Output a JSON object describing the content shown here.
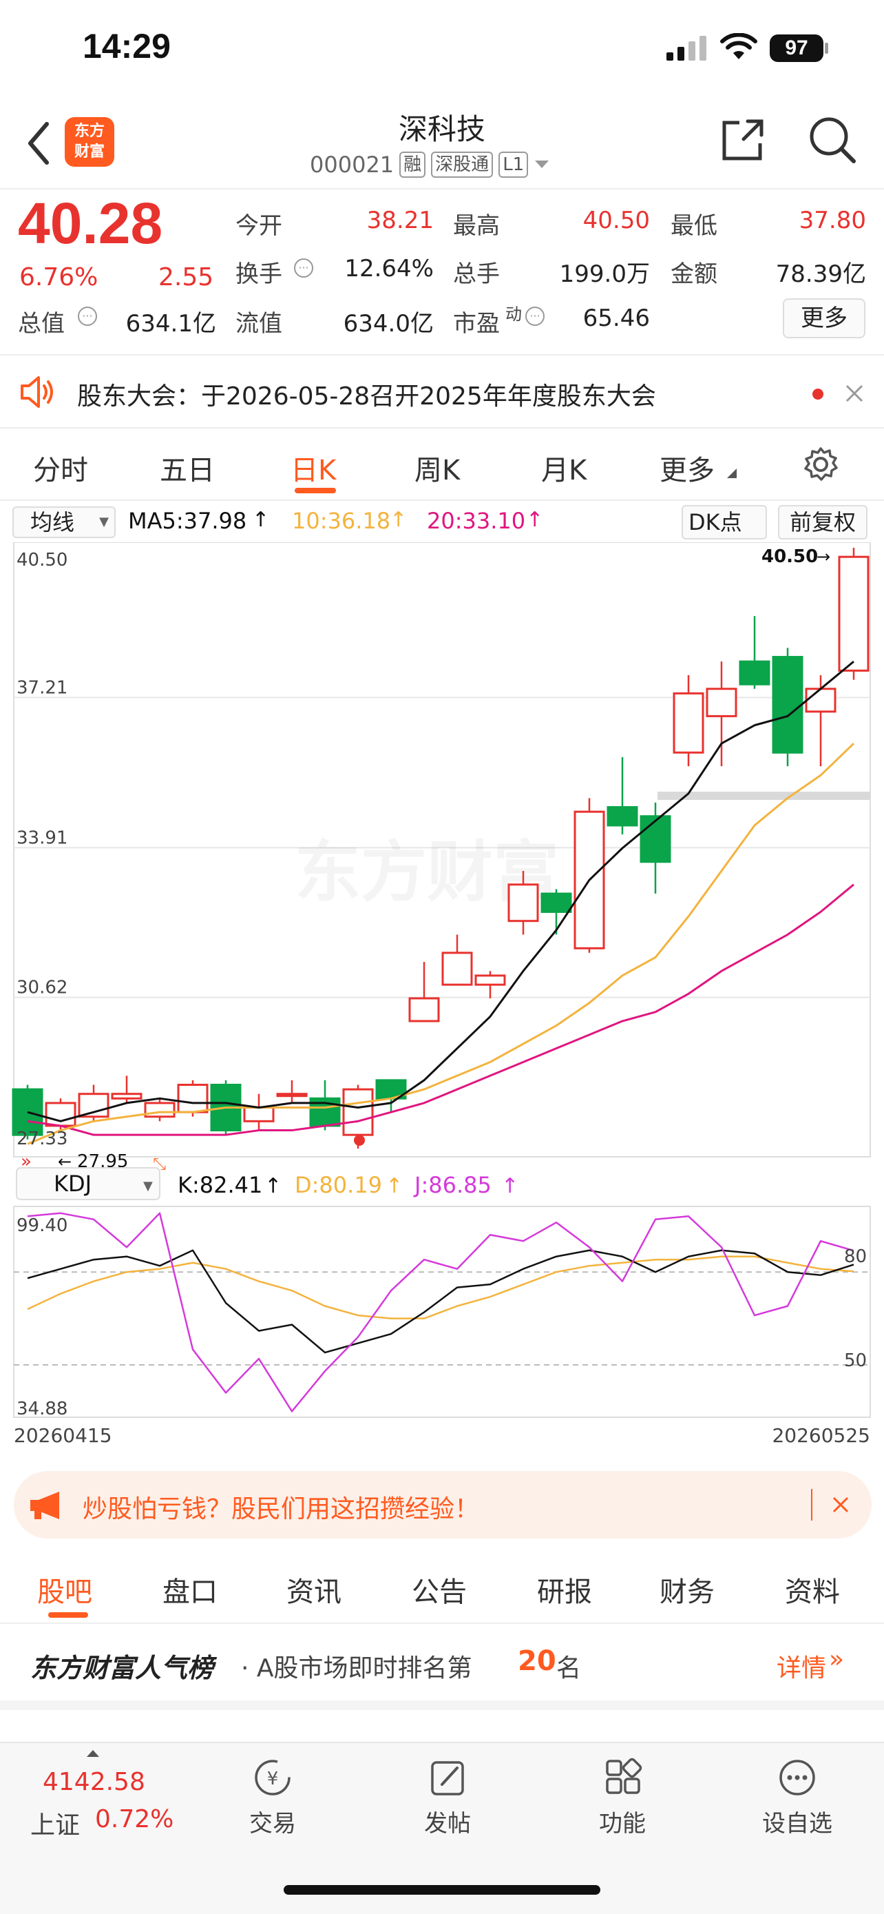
{
  "status_bar": {
    "time": "14:29",
    "battery": "97"
  },
  "header": {
    "back_label": "",
    "logo_line1": "东方",
    "logo_line2": "财富",
    "title": "深科技",
    "code": "000021",
    "tags": [
      "融",
      "深股通",
      "L1"
    ]
  },
  "quote": {
    "price": "40.28",
    "change_pct": "6.76%",
    "change": "2.55",
    "open_label": "今开",
    "open": "38.21",
    "high_label": "最高",
    "high": "40.50",
    "low_label": "最低",
    "low": "37.80",
    "turnover_label": "换手",
    "turnover": "12.64%",
    "volume_label": "总手",
    "volume": "199.0万",
    "amount_label": "金额",
    "amount": "78.39亿",
    "mktcap_label": "总值",
    "mktcap": "634.1亿",
    "float_label": "流值",
    "float_cap": "634.0亿",
    "pe_label": "市盈",
    "pe_sup": "动",
    "pe": "65.46",
    "more_button": "更多"
  },
  "notice": {
    "text": "股东大会：于2026-05-28召开2025年年度股东大会"
  },
  "chart_tabs": [
    "分时",
    "五日",
    "日K",
    "周K",
    "月K",
    "更多"
  ],
  "chart_tabs_active": 2,
  "ma_bar": {
    "selector": "均线",
    "ma5": "MA5:37.98",
    "ma10": "10:36.18",
    "ma20": "20:33.10",
    "dk_button": "DK点",
    "adjust_button": "前复权"
  },
  "colors": {
    "up": "#e8322e",
    "down": "#0aa44a",
    "ma5": "#111111",
    "ma10": "#f3b33d",
    "ma20": "#e0157f",
    "j_line": "#d43adb",
    "accent": "#ff5a1f"
  },
  "chart_data": {
    "type": "candlestick",
    "y_labels": [
      "40.50",
      "37.21",
      "33.91",
      "30.62",
      "27.33"
    ],
    "ylim": [
      27.33,
      40.5
    ],
    "high_marker": "40.50",
    "low_marker": "27.95",
    "x_start": "20260415",
    "x_end": "20260525",
    "watermark": "东方财富",
    "candles": [
      {
        "o": 28.6,
        "c": 27.6,
        "h": 28.7,
        "l": 27.5
      },
      {
        "o": 27.8,
        "c": 28.3,
        "h": 28.4,
        "l": 27.7
      },
      {
        "o": 28.0,
        "c": 28.5,
        "h": 28.7,
        "l": 27.9
      },
      {
        "o": 28.4,
        "c": 28.5,
        "h": 28.9,
        "l": 28.3
      },
      {
        "o": 28.0,
        "c": 28.3,
        "h": 28.4,
        "l": 27.9
      },
      {
        "o": 28.1,
        "c": 28.7,
        "h": 28.8,
        "l": 28.0
      },
      {
        "o": 28.7,
        "c": 27.7,
        "h": 28.8,
        "l": 27.6
      },
      {
        "o": 27.9,
        "c": 28.2,
        "h": 28.5,
        "l": 27.7
      },
      {
        "o": 28.5,
        "c": 28.5,
        "h": 28.8,
        "l": 28.3
      },
      {
        "o": 28.4,
        "c": 27.8,
        "h": 28.8,
        "l": 27.7
      },
      {
        "o": 27.6,
        "c": 28.6,
        "h": 28.7,
        "l": 27.3
      },
      {
        "o": 28.8,
        "c": 28.4,
        "h": 28.8,
        "l": 28.1
      },
      {
        "o": 30.1,
        "c": 30.6,
        "h": 31.4,
        "l": 30.1
      },
      {
        "o": 30.9,
        "c": 31.6,
        "h": 32.0,
        "l": 30.9
      },
      {
        "o": 30.9,
        "c": 31.1,
        "h": 31.2,
        "l": 30.6
      },
      {
        "o": 32.3,
        "c": 33.1,
        "h": 33.4,
        "l": 32.0
      },
      {
        "o": 32.9,
        "c": 32.5,
        "h": 33.0,
        "l": 32.0
      },
      {
        "o": 31.7,
        "c": 34.7,
        "h": 35.0,
        "l": 31.6
      },
      {
        "o": 34.8,
        "c": 34.4,
        "h": 35.9,
        "l": 34.2
      },
      {
        "o": 34.6,
        "c": 33.6,
        "h": 34.9,
        "l": 32.9
      },
      {
        "o": 36.0,
        "c": 37.3,
        "h": 37.7,
        "l": 35.7
      },
      {
        "o": 36.8,
        "c": 37.4,
        "h": 38.0,
        "l": 35.7
      },
      {
        "o": 38.0,
        "c": 37.5,
        "h": 39.0,
        "l": 37.4
      },
      {
        "o": 38.1,
        "c": 36.0,
        "h": 38.3,
        "l": 35.7
      },
      {
        "o": 36.9,
        "c": 37.4,
        "h": 37.7,
        "l": 35.7
      },
      {
        "o": 37.8,
        "c": 40.3,
        "h": 40.5,
        "l": 37.6
      }
    ],
    "ma5": [
      28.1,
      27.9,
      28.1,
      28.3,
      28.4,
      28.3,
      28.3,
      28.2,
      28.3,
      28.3,
      28.2,
      28.3,
      28.8,
      29.5,
      30.2,
      31.2,
      32.1,
      33.2,
      33.9,
      34.5,
      35.1,
      36.2,
      36.6,
      36.8,
      37.4,
      38.0
    ],
    "ma10": [
      27.4,
      27.7,
      27.9,
      28.0,
      28.1,
      28.1,
      28.2,
      28.2,
      28.2,
      28.2,
      28.3,
      28.4,
      28.6,
      28.9,
      29.2,
      29.6,
      30.0,
      30.5,
      31.1,
      31.5,
      32.4,
      33.4,
      34.4,
      35.0,
      35.5,
      36.2
    ],
    "ma20": [
      27.9,
      27.8,
      27.6,
      27.6,
      27.6,
      27.6,
      27.6,
      27.7,
      27.7,
      27.8,
      27.9,
      28.1,
      28.3,
      28.6,
      28.9,
      29.2,
      29.5,
      29.8,
      30.1,
      30.3,
      30.7,
      31.2,
      31.6,
      32.0,
      32.5,
      33.1
    ],
    "support_level": 35.05
  },
  "kdj": {
    "selector": "KDJ",
    "k_label": "K:82.41",
    "d_label": "D:80.19",
    "j_label": "J:86.85",
    "y_top": "99.40",
    "y_bottom": "34.88",
    "line80": "80",
    "line50": "50",
    "ylim": [
      34.88,
      99.4
    ],
    "k": [
      78,
      81,
      84,
      85,
      82,
      87,
      70,
      61,
      63,
      54,
      57,
      60,
      67,
      75,
      76,
      81,
      85,
      87,
      85,
      80,
      85,
      87,
      86,
      80,
      79,
      82.4
    ],
    "d": [
      68,
      73,
      77,
      80,
      81,
      83,
      81,
      77,
      74,
      69,
      66,
      65,
      65,
      69,
      72,
      76,
      80,
      82,
      83,
      84,
      84,
      85,
      85,
      83,
      81,
      80.2
    ],
    "j": [
      98,
      99,
      97,
      88,
      99,
      55,
      41,
      52,
      35,
      48,
      59,
      74,
      84,
      81,
      92,
      90,
      96,
      88,
      77,
      97,
      98,
      88,
      66,
      69,
      90,
      86.9
    ]
  },
  "banner": {
    "text": "炒股怕亏钱？股民们用这招攒经验！"
  },
  "bottom_tabs": [
    "股吧",
    "盘口",
    "资讯",
    "公告",
    "研报",
    "财务",
    "资料"
  ],
  "rank": {
    "brand": "东方财富人气榜",
    "prefix": "· A股市场即时排名第",
    "rank": "20",
    "suffix": "名",
    "detail": "详情"
  },
  "footer": {
    "index_value": "4142.58",
    "index_name": "上证",
    "index_change": "0.72%",
    "items": [
      "交易",
      "发帖",
      "功能",
      "设自选"
    ]
  }
}
